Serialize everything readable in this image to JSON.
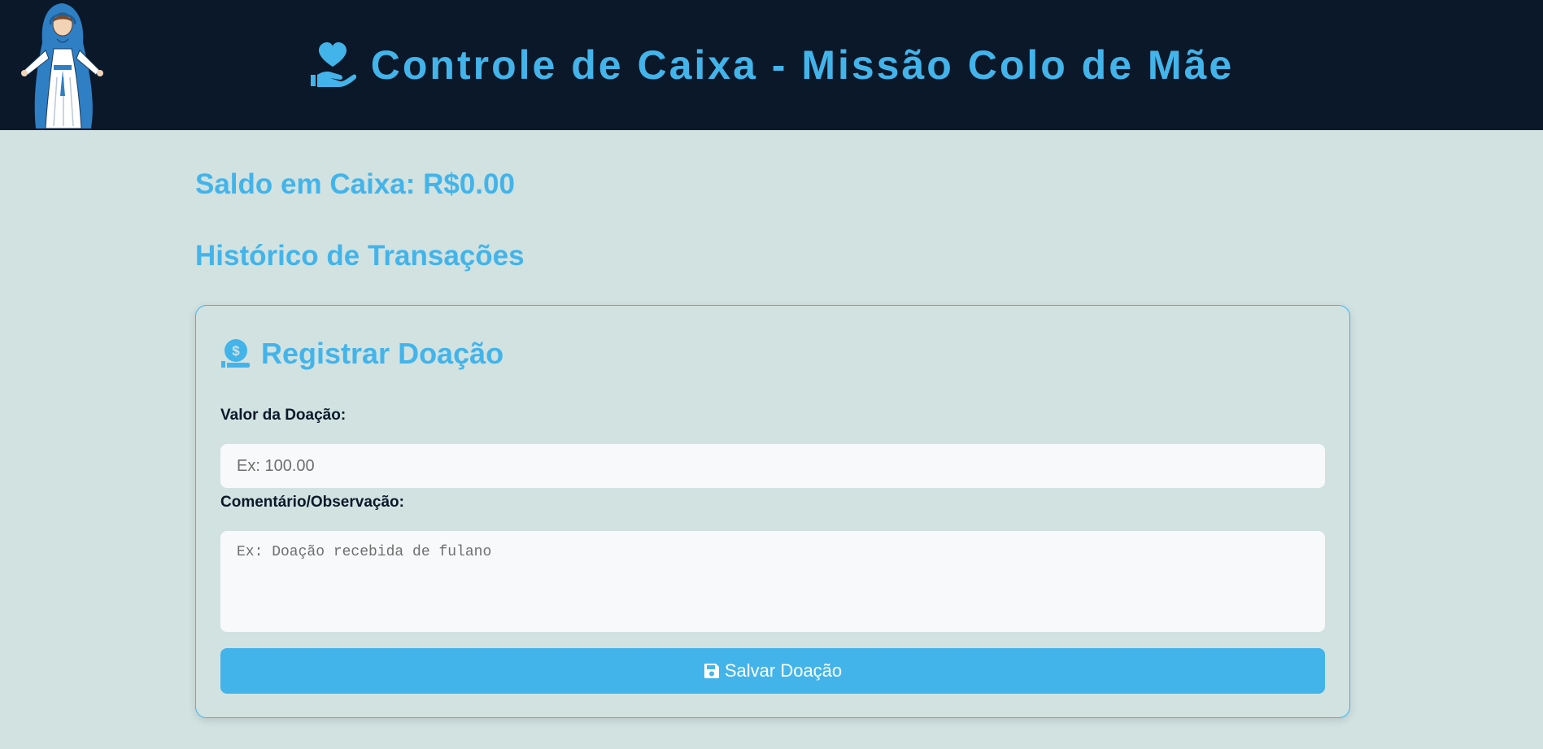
{
  "header": {
    "title": "Controle de Caixa - Missão Colo de Mãe",
    "title_icon": "hand-holding-heart-icon",
    "logo": "virgin-mary-illustration"
  },
  "saldo": {
    "text": "Saldo em Caixa: R$0.00"
  },
  "historico": {
    "text": "Histórico de Transações"
  },
  "form": {
    "title": "Registrar Doação",
    "title_icon": "hand-holding-dollar-icon",
    "valor_label": "Valor da Doação:",
    "valor_placeholder": "Ex: 100.00",
    "comentario_label": "Comentário/Observação:",
    "comentario_placeholder": "Ex: Doação recebida de fulano",
    "save_label": "Salvar Doação",
    "save_icon": "floppy-disk-icon"
  },
  "colors": {
    "header_bg": "#0b1829",
    "page_bg": "#d1e2e1",
    "accent": "#43b4ea",
    "input_bg": "#f7f9fa"
  }
}
